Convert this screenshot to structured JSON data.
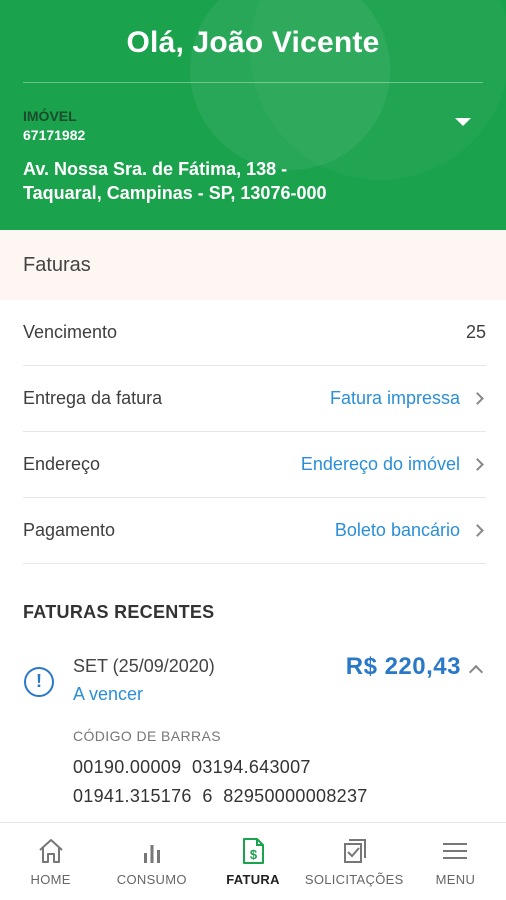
{
  "header": {
    "greeting": "Olá, João Vicente",
    "property_label": "IMÓVEL",
    "property_id": "67171982",
    "address_line1": "Av. Nossa Sra. de Fátima, 138 -",
    "address_line2": "Taquaral, Campinas - SP, 13076-000",
    "color": "#1aa24d"
  },
  "faturas": {
    "title": "Faturas",
    "rows": [
      {
        "label": "Vencimento",
        "value": "25"
      },
      {
        "label": "Entrega da fatura",
        "value": "Fatura impressa"
      },
      {
        "label": "Endereço",
        "value": "Endereço do imóvel"
      },
      {
        "label": "Pagamento",
        "value": "Boleto bancário"
      }
    ]
  },
  "recent": {
    "title": "FATURAS RECENTES",
    "invoice": {
      "icon": "alert-circle-icon",
      "month": "SET (25/09/2020)",
      "status": "A vencer",
      "amount": "R$ 220,43",
      "barcode_label": "CÓDIGO DE BARRAS",
      "barcode_line1": "00190.00009  03194.643007",
      "barcode_line2": "01941.315176  6  82950000008237"
    }
  },
  "nav": [
    {
      "label": "HOME",
      "icon": "home-icon"
    },
    {
      "label": "CONSUMO",
      "icon": "bar-chart-icon"
    },
    {
      "label": "FATURA",
      "icon": "invoice-dollar-icon",
      "active": true
    },
    {
      "label": "SOLICITAÇÕES",
      "icon": "checklist-icon"
    },
    {
      "label": "MENU",
      "icon": "hamburger-icon"
    }
  ],
  "colors": {
    "accent_blue": "#2a78c8",
    "link_blue": "#2a8fd6",
    "active_green": "#1aa24d"
  }
}
